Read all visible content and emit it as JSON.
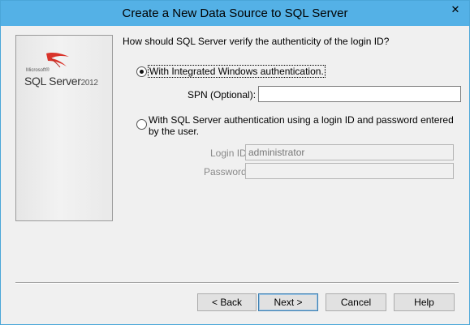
{
  "window": {
    "title": "Create a New Data Source to SQL Server",
    "close_glyph": "✕"
  },
  "logo": {
    "microsoft": "Microsoft®",
    "product": "SQL Server",
    "year": "2012"
  },
  "main": {
    "question": "How should SQL Server verify the authenticity of the login ID?",
    "auth_options": [
      {
        "label": "With Integrated Windows authentication.",
        "selected": true
      },
      {
        "label": "With SQL Server authentication using a login ID and password entered by the user.",
        "selected": false
      }
    ],
    "spn": {
      "label": "SPN (Optional):",
      "value": ""
    },
    "login_id": {
      "label": "Login ID:",
      "value": "administrator"
    },
    "password": {
      "label": "Password:",
      "value": ""
    }
  },
  "buttons": {
    "back": "< Back",
    "next": "Next >",
    "cancel": "Cancel",
    "help": "Help"
  }
}
